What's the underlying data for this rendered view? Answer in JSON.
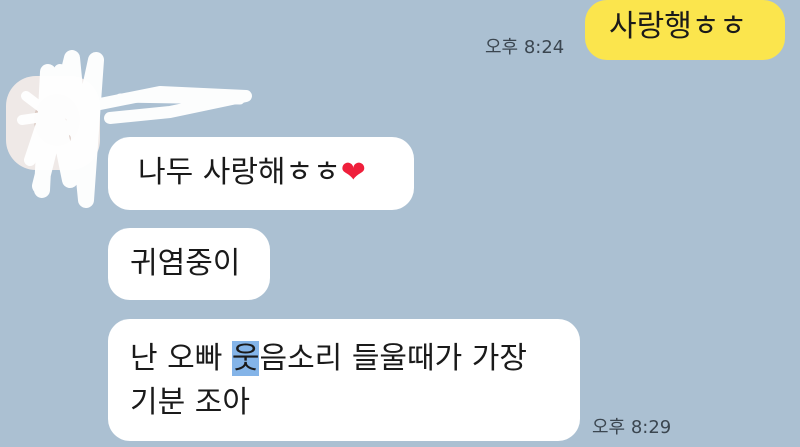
{
  "messages": {
    "sent": {
      "text": "사랑행ㅎㅎ",
      "time": "오후 8:24"
    },
    "received_1": {
      "text": "나두 사랑해ㅎㅎ",
      "emoji": "❤"
    },
    "received_2": {
      "text": "귀염중이"
    },
    "received_3": {
      "line1_a": "난 오빠 ",
      "line1_sel": "웃",
      "line1_b": "음소리 들울때가 가장",
      "line2": "기분 조아",
      "time": "오후 8:29"
    }
  },
  "colors": {
    "background": "#abc0d2",
    "sent_bubble": "#fbe54d",
    "received_bubble": "#ffffff",
    "selection": "#84b4e8"
  },
  "icons": {
    "emoji": "red-heart-icon"
  }
}
